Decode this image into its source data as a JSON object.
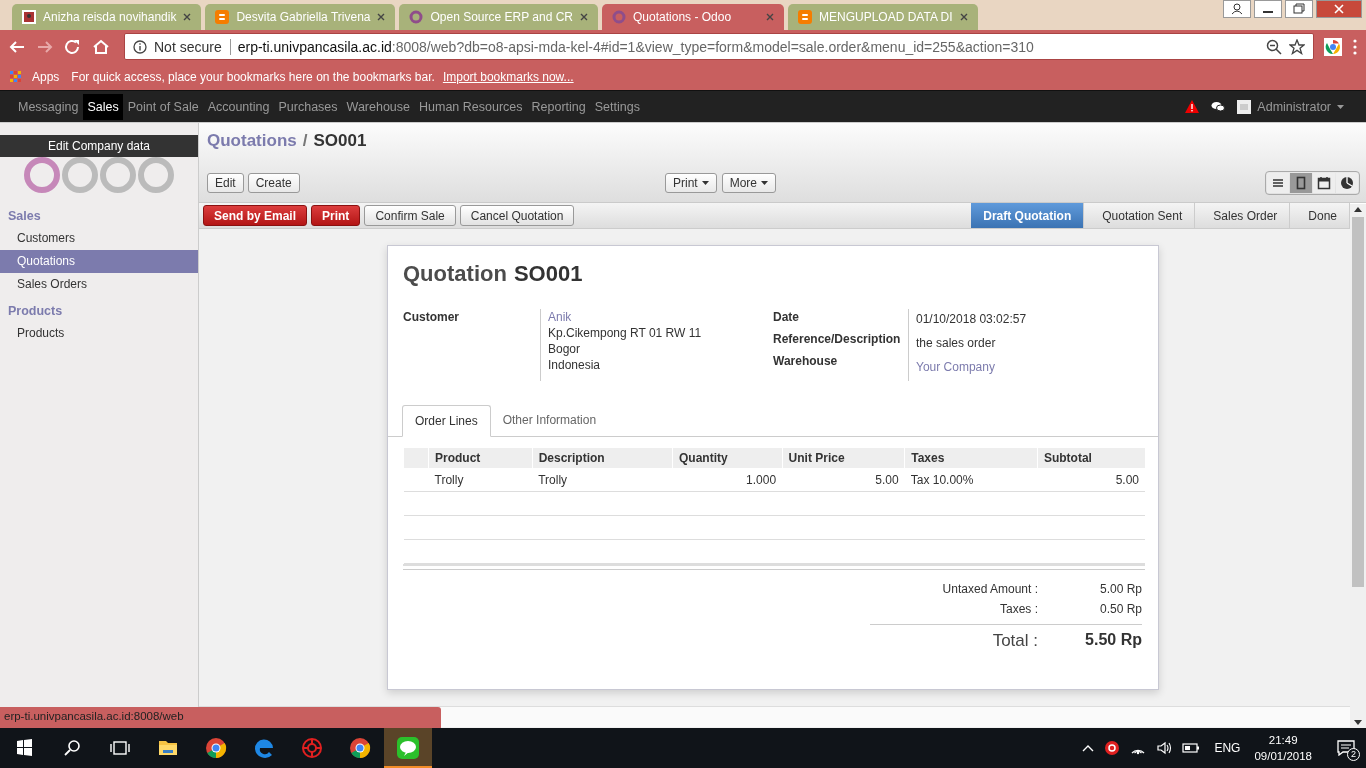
{
  "browser": {
    "tabs": [
      {
        "title": "Anizha reisda novihandik",
        "kind": "picture",
        "selected": false
      },
      {
        "title": "Desvita Gabriella Trivena",
        "kind": "blogger",
        "selected": false
      },
      {
        "title": "Open Source ERP and CR",
        "kind": "odoo",
        "selected": false
      },
      {
        "title": "Quotations - Odoo",
        "kind": "odoo",
        "selected": true
      },
      {
        "title": "MENGUPLOAD DATA DI",
        "kind": "blogger",
        "selected": false
      }
    ],
    "security": "Not secure",
    "url_host": "erp-ti.univpancasila.ac.id",
    "url_rest": ":8008/web?db=o8-apsi-mda-kel-4#id=1&view_type=form&model=sale.order&menu_id=255&action=310",
    "bookmarks": {
      "apps": "Apps",
      "hint": "For quick access, place your bookmarks here on the bookmarks bar.",
      "link": "Import bookmarks now..."
    }
  },
  "nav": {
    "items": [
      {
        "label": "Messaging",
        "selected": false
      },
      {
        "label": "Sales",
        "selected": true
      },
      {
        "label": "Point of Sale",
        "selected": false
      },
      {
        "label": "Accounting",
        "selected": false
      },
      {
        "label": "Purchases",
        "selected": false
      },
      {
        "label": "Warehouse",
        "selected": false
      },
      {
        "label": "Human Resources",
        "selected": false
      },
      {
        "label": "Reporting",
        "selected": false
      },
      {
        "label": "Settings",
        "selected": false
      }
    ],
    "user": "Administrator"
  },
  "sidebar": {
    "company_label": "Edit Company data",
    "sections": [
      {
        "title": "Sales",
        "items": [
          {
            "label": "Customers",
            "selected": false
          },
          {
            "label": "Quotations",
            "selected": true
          },
          {
            "label": "Sales Orders",
            "selected": false
          }
        ]
      },
      {
        "title": "Products",
        "items": [
          {
            "label": "Products",
            "selected": false
          }
        ]
      }
    ]
  },
  "breadcrumb": {
    "parent": "Quotations",
    "separator": "/",
    "current": "SO001"
  },
  "toolbar": {
    "left": [
      "Edit",
      "Create"
    ],
    "menus": [
      "Print",
      "More"
    ],
    "views": [
      {
        "kind": "list",
        "selected": false
      },
      {
        "kind": "form",
        "selected": true
      },
      {
        "kind": "calendar",
        "selected": false
      },
      {
        "kind": "graph",
        "selected": false
      }
    ]
  },
  "actions": [
    {
      "label": "Send by Email",
      "kind": "primary"
    },
    {
      "label": "Print",
      "kind": "primary"
    },
    {
      "label": "Confirm Sale",
      "kind": "default"
    },
    {
      "label": "Cancel Quotation",
      "kind": "default"
    }
  ],
  "statusbar": [
    {
      "label": "Draft Quotation",
      "selected": true
    },
    {
      "label": "Quotation Sent",
      "selected": false
    },
    {
      "label": "Sales Order",
      "selected": false
    },
    {
      "label": "Done",
      "selected": false
    }
  ],
  "form": {
    "title": "Quotation",
    "number": "SO001",
    "customer": {
      "label": "Customer",
      "name": "Anik",
      "address": [
        "Kp.Cikempong RT 01 RW 11",
        "Bogor",
        "Indonesia"
      ]
    },
    "fields": [
      {
        "label": "Date",
        "value": "01/10/2018 03:02:57",
        "kind": "text"
      },
      {
        "label": "Reference/Description",
        "value": "the sales order",
        "kind": "text"
      },
      {
        "label": "Warehouse",
        "value": "Your Company",
        "kind": "link"
      }
    ],
    "tabs": [
      {
        "label": "Order Lines",
        "selected": true
      },
      {
        "label": "Other Information",
        "selected": false
      }
    ],
    "table": {
      "columns": [
        "Product",
        "Description",
        "Quantity",
        "Unit Price",
        "Taxes",
        "Subtotal"
      ],
      "rows": [
        [
          "Trolly",
          "Trolly",
          "1.000",
          "5.00",
          "Tax 10.00%",
          "5.00"
        ]
      ]
    },
    "totals": [
      {
        "label": "Untaxed Amount :",
        "value": "5.00 Rp"
      },
      {
        "label": "Taxes :",
        "value": "0.50 Rp"
      }
    ],
    "total": {
      "label": "Total :",
      "value": "5.50 Rp"
    }
  },
  "status_url": "erp-ti.univpancasila.ac.id:8008/web",
  "taskbar": {
    "apps": [
      {
        "kind": "explorer",
        "selected": false
      },
      {
        "kind": "chrome",
        "selected": false
      },
      {
        "kind": "edge",
        "selected": false
      },
      {
        "kind": "red",
        "selected": false
      },
      {
        "kind": "chrome",
        "selected": false
      },
      {
        "kind": "line",
        "selected": true
      }
    ],
    "language": "ENG",
    "time": "21:49",
    "date": "09/01/2018",
    "notifications": "2"
  }
}
